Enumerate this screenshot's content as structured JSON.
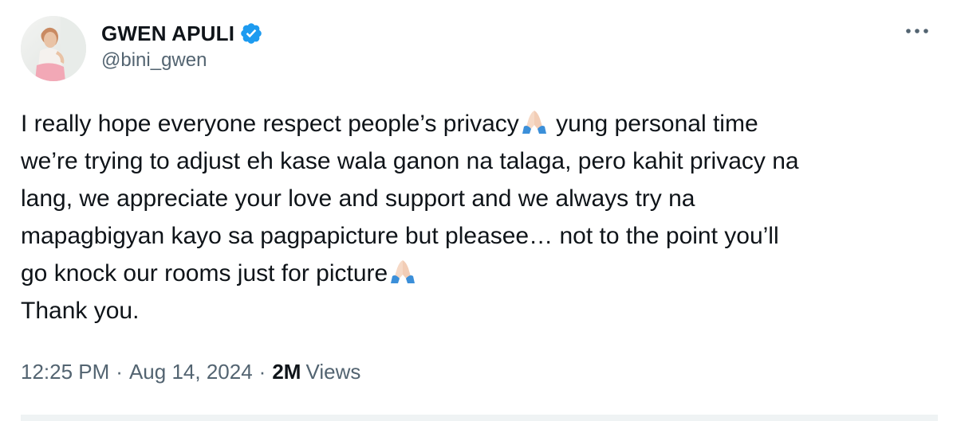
{
  "author": {
    "display_name": "GWEN APULI",
    "handle": "@bini_gwen",
    "verified": true
  },
  "tweet": {
    "lines": [
      {
        "before": "I really hope everyone respect people’s privacy",
        "emoji": "folded-hands-icon",
        "after": " yung personal time"
      },
      {
        "text": "we’re trying to adjust eh kase wala ganon na talaga, pero kahit privacy na"
      },
      {
        "text": "lang, we appreciate your love and support and we always try na"
      },
      {
        "text": "mapagbigyan kayo sa pagpapicture but pleasee… not to the point you’ll"
      },
      {
        "before": "go knock our rooms just for picture",
        "emoji": "folded-hands-icon",
        "after": ""
      },
      {
        "text": "Thank you."
      }
    ]
  },
  "meta": {
    "time": "12:25 PM",
    "date": "Aug 14, 2024",
    "views_count": "2M",
    "views_label": "Views",
    "separator": "·"
  },
  "colors": {
    "verified_blue": "#1d9bf0",
    "text_primary": "#0f1419",
    "text_secondary": "#536471"
  },
  "icons": [
    "verified-badge-icon",
    "more-options-icon",
    "folded-hands-icon"
  ]
}
